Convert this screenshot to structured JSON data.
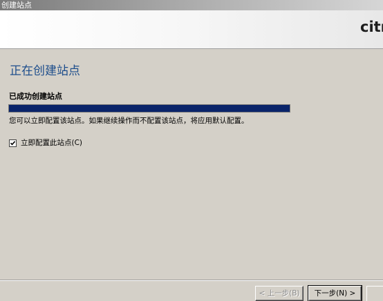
{
  "window": {
    "title": "创建站点"
  },
  "banner": {
    "logo_text": "citr"
  },
  "page": {
    "title": "正在创建站点",
    "status_label": "已成功创建站点",
    "progress_percent": 100,
    "info_text": "您可以立即配置该站点。如果继续操作而不配置该站点，将应用默认配置。"
  },
  "options": {
    "configure_now": {
      "label": "立即配置此站点(C)",
      "checked": true
    }
  },
  "buttons": {
    "back_label": "< 上一步(B)",
    "next_label": "下一步(N) >"
  },
  "colors": {
    "title_blue": "#1e4e8c",
    "progress_fill": "#0a246a",
    "dialog_bg": "#d4d0c8"
  }
}
